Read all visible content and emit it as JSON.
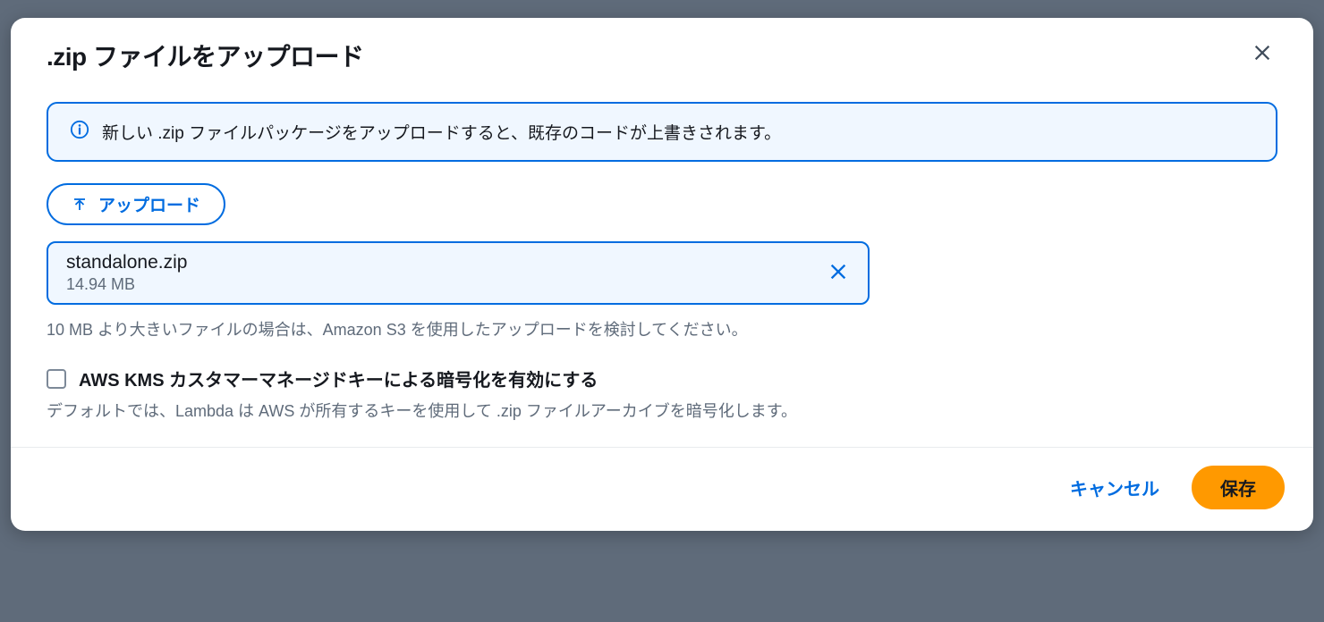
{
  "modal": {
    "title": ".zip ファイルをアップロード",
    "info_text": "新しい .zip ファイルパッケージをアップロードすると、既存のコードが上書きされます。",
    "upload_button_label": "アップロード",
    "file": {
      "name": "standalone.zip",
      "size": "14.94 MB"
    },
    "size_help_text": "10 MB より大きいファイルの場合は、Amazon S3 を使用したアップロードを検討してください。",
    "kms": {
      "label": "AWS KMS カスタマーマネージドキーによる暗号化を有効にする",
      "help": "デフォルトでは、Lambda は AWS が所有するキーを使用して .zip ファイルアーカイブを暗号化します。",
      "checked": false
    },
    "footer": {
      "cancel_label": "キャンセル",
      "save_label": "保存"
    }
  }
}
